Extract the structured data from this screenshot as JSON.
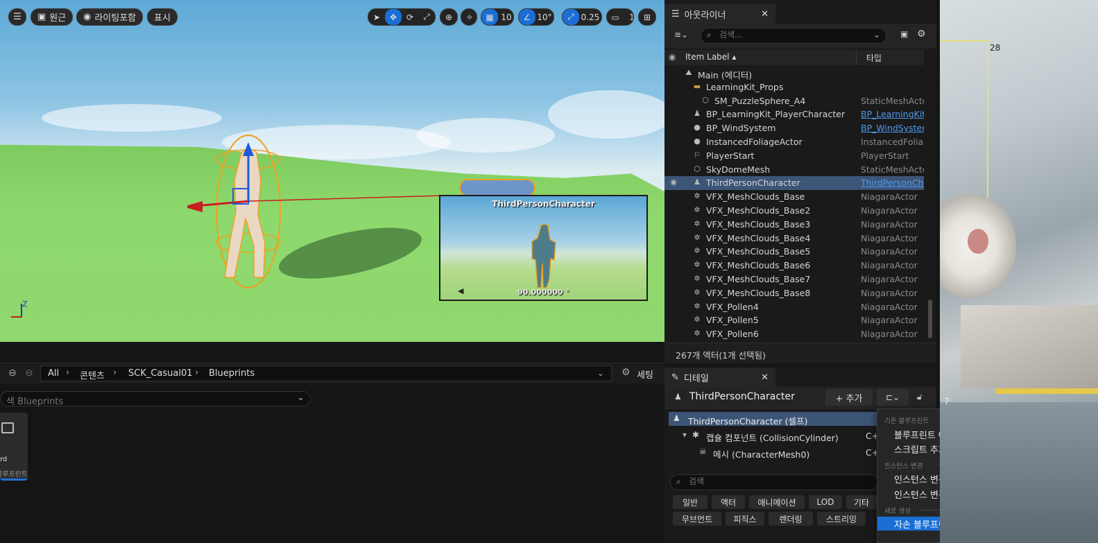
{
  "viewport": {
    "menu_icon": "hamburger-icon",
    "perspective_label": "원근",
    "lighting_label": "라이팅포함",
    "show_label": "표시",
    "grid_snap_value": "10",
    "rotation_snap_value": "10°",
    "scale_snap_value": "0.25",
    "camera_speed_value": "1",
    "preview_caption": "ThirdPersonCharacter",
    "preview_angle": "90.000000 °",
    "axis_label": "Z"
  },
  "content_browser": {
    "breadcrumbs": [
      "All",
      "콘텐츠",
      "SCK_Casual01",
      "Blueprints"
    ],
    "settings_label": "세팅",
    "filter_text": "색 Blueprints",
    "asset_tile_line1": "rd",
    "asset_tile_line2": "블루프린트"
  },
  "outliner": {
    "tab_title": "아웃라이너",
    "search_placeholder": "검색...",
    "col_label": "Item Label ▴",
    "col_type": "타입",
    "rows": [
      {
        "label": "Main (에디터)",
        "type": "",
        "icon": "level-icon"
      },
      {
        "label": "LearningKit_Props",
        "type": "",
        "icon": "folder-icon"
      },
      {
        "label": "SM_PuzzleSphere_A4",
        "type": "StaticMeshActor",
        "icon": "cube-icon"
      },
      {
        "label": "BP_LearningKit_PlayerCharacter",
        "type": "BP_LearningKit_",
        "icon": "pawn-icon",
        "link": true
      },
      {
        "label": "BP_WindSystem",
        "type": "BP_WindSystem",
        "icon": "actor-icon",
        "link": true
      },
      {
        "label": "InstancedFoliageActor",
        "type": "InstancedFoliage",
        "icon": "actor-icon"
      },
      {
        "label": "PlayerStart",
        "type": "PlayerStart",
        "icon": "player-start-icon"
      },
      {
        "label": "SkyDomeMesh",
        "type": "StaticMeshActor",
        "icon": "cube-icon"
      },
      {
        "label": "ThirdPersonCharacter",
        "type": "ThirdPersonCha",
        "icon": "pawn-icon",
        "link": true,
        "selected": true
      },
      {
        "label": "VFX_MeshClouds_Base",
        "type": "NiagaraActor",
        "icon": "niagara-icon"
      },
      {
        "label": "VFX_MeshClouds_Base2",
        "type": "NiagaraActor",
        "icon": "niagara-icon"
      },
      {
        "label": "VFX_MeshClouds_Base3",
        "type": "NiagaraActor",
        "icon": "niagara-icon"
      },
      {
        "label": "VFX_MeshClouds_Base4",
        "type": "NiagaraActor",
        "icon": "niagara-icon"
      },
      {
        "label": "VFX_MeshClouds_Base5",
        "type": "NiagaraActor",
        "icon": "niagara-icon"
      },
      {
        "label": "VFX_MeshClouds_Base6",
        "type": "NiagaraActor",
        "icon": "niagara-icon"
      },
      {
        "label": "VFX_MeshClouds_Base7",
        "type": "NiagaraActor",
        "icon": "niagara-icon"
      },
      {
        "label": "VFX_MeshClouds_Base8",
        "type": "NiagaraActor",
        "icon": "niagara-icon"
      },
      {
        "label": "VFX_Pollen4",
        "type": "NiagaraActor",
        "icon": "niagara-icon"
      },
      {
        "label": "VFX_Pollen5",
        "type": "NiagaraActor",
        "icon": "niagara-icon"
      },
      {
        "label": "VFX_Pollen6",
        "type": "NiagaraActor",
        "icon": "niagara-icon"
      }
    ],
    "status": "267개 액터(1개 선택됨)"
  },
  "details": {
    "tab_title": "디테일",
    "actor_name": "ThirdPersonCharacter",
    "add_label": "+ 추가",
    "components": [
      {
        "label": "ThirdPersonCharacter (셀프)",
        "suffix": ""
      },
      {
        "label": "캡슐 컴포넌트 (CollisionCylinder)",
        "suffix": "C+"
      },
      {
        "label": "메시 (CharacterMesh0)",
        "suffix": "C+"
      }
    ],
    "search_placeholder": "검색",
    "categories_row1": [
      "일반",
      "액터",
      "애니메이션",
      "LOD",
      "기타"
    ],
    "categories_row2": [
      "무브먼트",
      "피직스",
      "렌더링",
      "스트리밍"
    ]
  },
  "blueprint_menu": {
    "header_existing": "기존 블루프린트",
    "open_editor": "블루프린트 에디터 열기",
    "add_script": "스크립트 추가 또는 편집",
    "header_instance": "인스턴스 변경",
    "apply_changes": "인스턴스 변경사항을 블루프린트에 적용",
    "reset_changes": "인스턴스 변경 사항을 블루프린트 기본값으로 리셋",
    "header_new": "새로 생성",
    "create_child": "자손 블루프린트 클래스 생성"
  },
  "photo": {
    "label_top": "28",
    "label_bottom": "7"
  },
  "colors": {
    "accent": "#1a6fd6",
    "selection": "#3c5577",
    "panel": "#1a1a1a",
    "link": "#4d9bf0"
  }
}
